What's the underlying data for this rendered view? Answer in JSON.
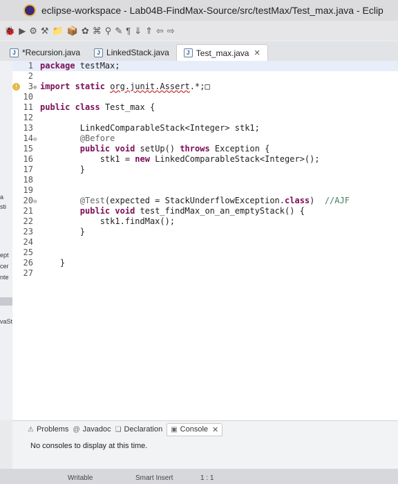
{
  "window": {
    "title": "eclipse-workspace - Lab04B-FindMax-Source/src/testMax/Test_max.java - Eclip"
  },
  "toolbar": {
    "icons": [
      "debug-icon",
      "run-icon",
      "coverage-icon",
      "external-tools-icon",
      "new-java-project-icon",
      "new-package-icon",
      "new-class-icon",
      "open-type-icon",
      "search-icon",
      "toggle-mark-occurrences-icon",
      "toggle-whitespace-icon",
      "next-annotation-icon",
      "previous-annotation-icon",
      "back-icon",
      "forward-icon"
    ],
    "glyphs": [
      "🐞",
      "▶",
      "⚙",
      "⚒",
      "📁",
      "📦",
      "✿",
      "⌘",
      "⚲",
      "✎",
      "¶",
      "⇓",
      "⇑",
      "⇦",
      "⇨"
    ]
  },
  "tabs": [
    {
      "label": "*Recursion.java",
      "icon": "java-file-icon",
      "icon_glyph": "J",
      "active": false
    },
    {
      "label": "LinkedStack.java",
      "icon": "java-file-icon",
      "icon_glyph": "J",
      "active": false
    },
    {
      "label": "Test_max.java",
      "icon": "java-file-icon",
      "icon_glyph": "J",
      "active": true,
      "close": "✕"
    }
  ],
  "left_fragments": [
    "a",
    "sti",
    "ept",
    "cer",
    "nte",
    "vaSt"
  ],
  "code": {
    "l1_num": "1",
    "l1_kw": "package",
    "l1_text": " testMax;",
    "l2_num": "2",
    "l3_num": "3",
    "l3_fold": "⊕",
    "l3_kw1": "import",
    "l3_kw2": "static",
    "l3_err": "org.junit.Assert",
    "l3_text": ".*;",
    "l3_box": "□",
    "l10_num": "10",
    "l11_num": "11",
    "l11_kw1": "public",
    "l11_kw2": "class",
    "l11_text": " Test_max {",
    "l12_num": "12",
    "l13_num": "13",
    "l13_text": "        LinkedComparableStack<Integer> stk1;",
    "l14_num": "14",
    "l14_fold": "⊖",
    "l14_ann": "        @Before",
    "l15_num": "15",
    "l15_kw1": "public",
    "l15_kw2": "void",
    "l15_text1": " setUp() ",
    "l15_kw3": "throws",
    "l15_text2": " Exception {",
    "l16_num": "16",
    "l16_text1": "            stk1 = ",
    "l16_kw": "new",
    "l16_text2": " LinkedComparableStack<Integer>();",
    "l17_num": "17",
    "l17_text": "        }",
    "l18_num": "18",
    "l19_num": "19",
    "l20_num": "20",
    "l20_fold": "⊖",
    "l20_ann": "        @Test",
    "l20_text1": "(expected = StackUnderflowException.",
    "l20_kw": "class",
    "l20_text2": ")  ",
    "l20_cmt": "//AJF",
    "l21_num": "21",
    "l21_kw1": "public",
    "l21_kw2": "void",
    "l21_text": " test_findMax_on_an_emptyStack() {",
    "l22_num": "22",
    "l22_text": "            stk1.findMax();",
    "l23_num": "23",
    "l23_text": "        }",
    "l24_num": "24",
    "l25_num": "25",
    "l26_num": "26",
    "l26_text": "    }",
    "l27_num": "27"
  },
  "console": {
    "tabs": [
      {
        "label": "Problems",
        "icon": "problems-icon",
        "glyph": "⚠"
      },
      {
        "label": "Javadoc",
        "icon": "javadoc-icon",
        "glyph": "@"
      },
      {
        "label": "Declaration",
        "icon": "declaration-icon",
        "glyph": "❏"
      },
      {
        "label": "Console",
        "icon": "console-icon",
        "glyph": "▣",
        "active": true,
        "close": "✕"
      }
    ],
    "message": "No consoles to display at this time."
  },
  "status": {
    "writable": "Writable",
    "insert_mode": "Smart Insert",
    "position": "1 : 1"
  }
}
